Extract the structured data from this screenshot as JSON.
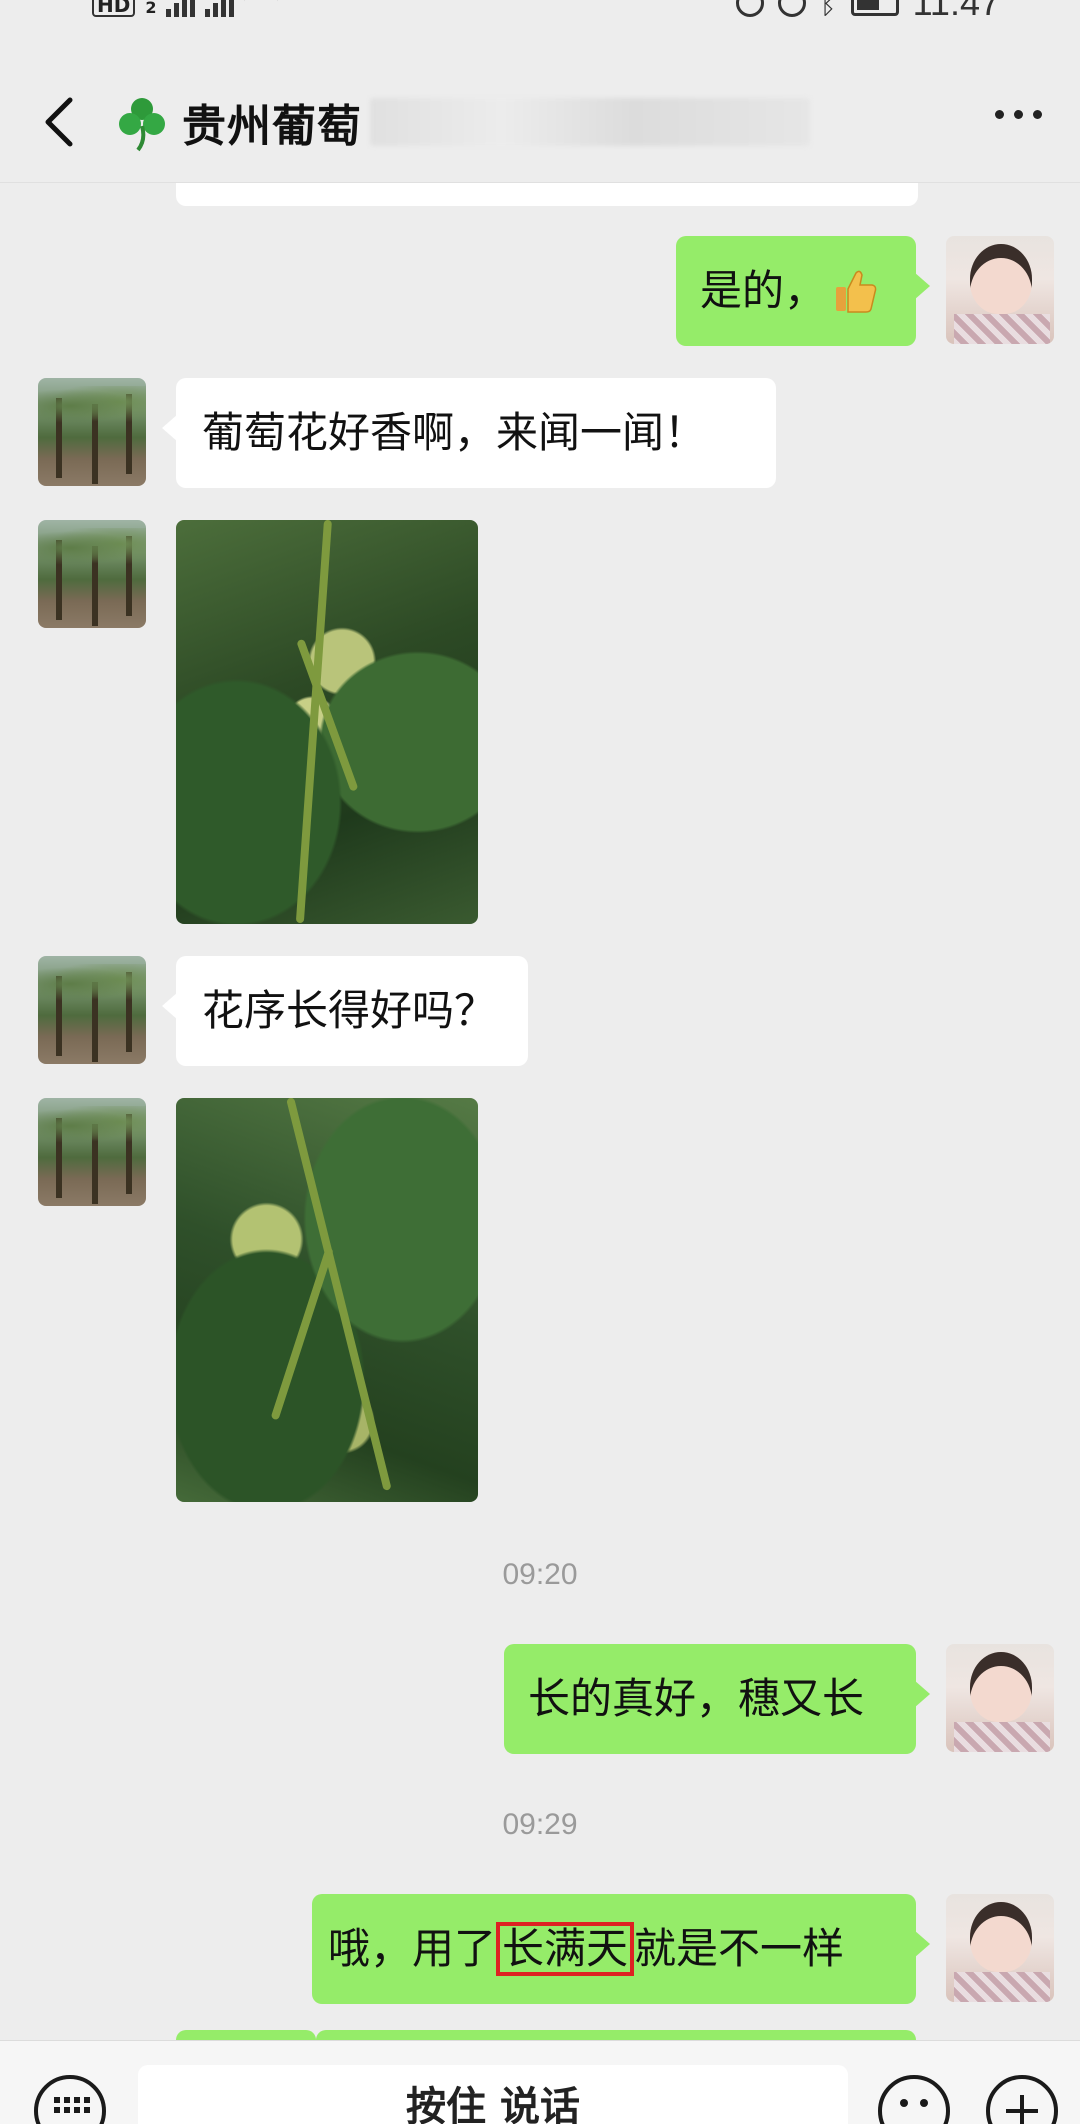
{
  "status_bar": {
    "network": "HD",
    "sim": "2",
    "time": "11:47"
  },
  "header": {
    "title": "贵州葡萄",
    "title_icon": "clover-icon"
  },
  "messages": [
    {
      "side": "right",
      "text": "是的，",
      "emoji": "thumbs-up-icon"
    },
    {
      "side": "left",
      "text": "葡萄花好香啊，来闻一闻！"
    },
    {
      "side": "left",
      "type": "image"
    },
    {
      "side": "left",
      "text": "花序长得好吗？"
    },
    {
      "side": "left",
      "type": "image"
    },
    {
      "type": "time",
      "text": "09:20"
    },
    {
      "side": "right",
      "text": "长的真好，穗又长"
    },
    {
      "type": "time",
      "text": "09:29"
    },
    {
      "side": "right",
      "text_before": "哦，用了",
      "text_highlight": "长满天",
      "text_after": "就是不一样"
    }
  ],
  "input_bar": {
    "voice_label": "按住 说话"
  },
  "colors": {
    "background": "#ededed",
    "outgoing_bubble": "#95ec69",
    "incoming_bubble": "#ffffff",
    "highlight_box": "#dd2222"
  }
}
